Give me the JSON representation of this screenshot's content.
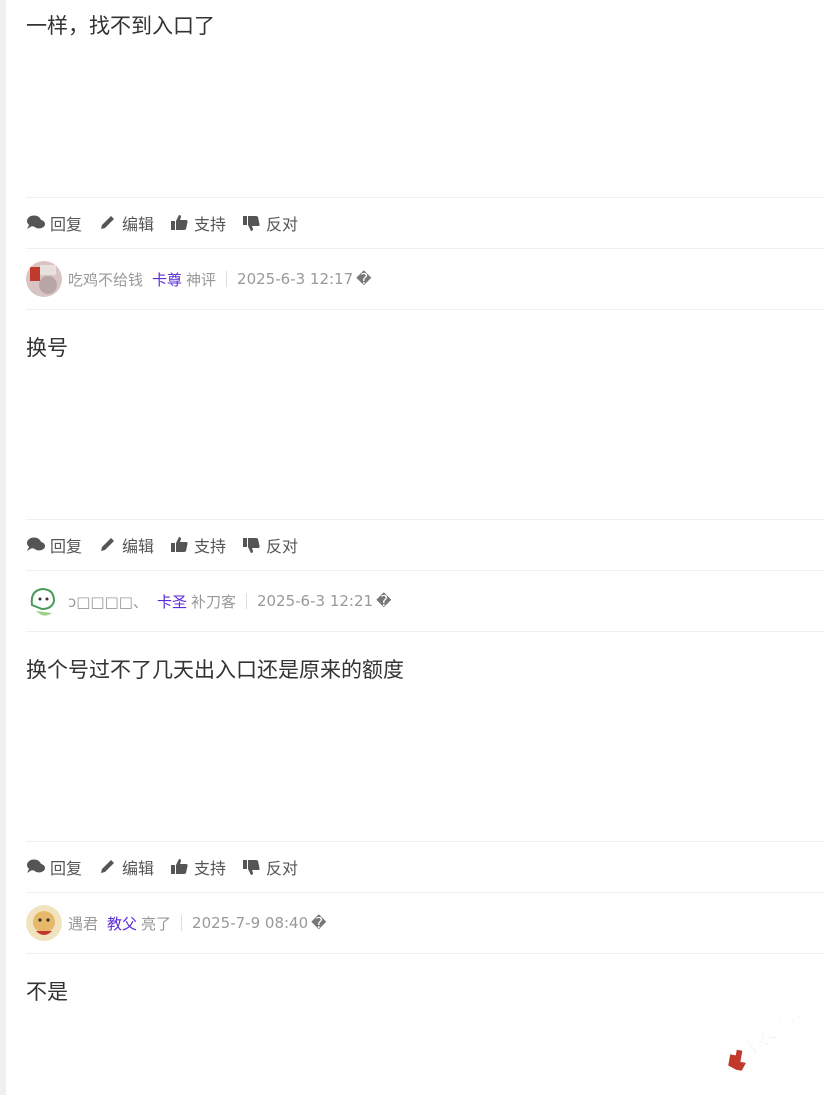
{
  "actions": {
    "reply": "回复",
    "edit": "编辑",
    "support": "支持",
    "oppose": "反对"
  },
  "posts": [
    {
      "text": "一样，找不到入口了"
    },
    {
      "username": "吃鸡不给钱",
      "role": "卡尊",
      "title": "神评",
      "time": "2025-6-3 12:17",
      "time_icon": "�",
      "text": "换号"
    },
    {
      "username": "ↄ□□□□、",
      "role": "卡圣",
      "title": "补刀客",
      "time": "2025-6-3 12:21",
      "time_icon": "�",
      "text": "换个号过不了几天出入口还是原来的额度"
    },
    {
      "username": "遇君",
      "role": "教父",
      "title": "亮了",
      "time": "2025-7-9 08:40",
      "time_icon": "�",
      "text": "不是"
    }
  ],
  "watermark": {
    "text": "卡农社区"
  },
  "colors": {
    "role": "#5a2bd6",
    "meta": "#999999",
    "icon": "#555555"
  }
}
